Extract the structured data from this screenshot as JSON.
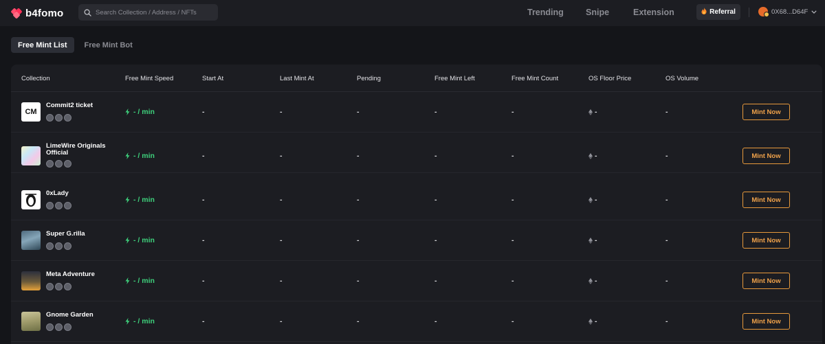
{
  "app": {
    "logo_text": "b4fomo"
  },
  "search": {
    "placeholder": "Search Collection / Address / NFTs"
  },
  "nav": {
    "trending": "Trending",
    "snipe": "Snipe",
    "extension": "Extension"
  },
  "referral": {
    "label": "Referral"
  },
  "wallet": {
    "address": "0X68...D64F"
  },
  "tabs": [
    {
      "label": "Free Mint List",
      "active": true
    },
    {
      "label": "Free Mint Bot",
      "active": false
    }
  ],
  "table": {
    "headers": {
      "collection": "Collection",
      "speed": "Free Mint Speed",
      "start_at": "Start At",
      "last_mint_at": "Last Mint At",
      "pending": "Pending",
      "free_mint_left": "Free Mint Left",
      "free_mint_count": "Free Mint Count",
      "os_floor_price": "OS Floor Price",
      "os_volume": "OS Volume"
    },
    "rows": [
      {
        "name": "Commit2 ticket",
        "thumb_text": "CM",
        "speed": "- / min",
        "start_at": "-",
        "last_mint_at": "-",
        "pending": "-",
        "free_mint_left": "-",
        "free_mint_count": "-",
        "os_floor_price": "-",
        "os_volume": "-",
        "action": "Mint Now"
      },
      {
        "name": "LimeWire Originals Official",
        "thumb_text": "",
        "speed": "- / min",
        "start_at": "-",
        "last_mint_at": "-",
        "pending": "-",
        "free_mint_left": "-",
        "free_mint_count": "-",
        "os_floor_price": "-",
        "os_volume": "-",
        "action": "Mint Now"
      },
      {
        "name": "0xLady",
        "thumb_text": "",
        "speed": "- / min",
        "start_at": "-",
        "last_mint_at": "-",
        "pending": "-",
        "free_mint_left": "-",
        "free_mint_count": "-",
        "os_floor_price": "-",
        "os_volume": "-",
        "action": "Mint Now"
      },
      {
        "name": "Super G.rilla",
        "thumb_text": "",
        "speed": "- / min",
        "start_at": "-",
        "last_mint_at": "-",
        "pending": "-",
        "free_mint_left": "-",
        "free_mint_count": "-",
        "os_floor_price": "-",
        "os_volume": "-",
        "action": "Mint Now"
      },
      {
        "name": "Meta Adventure",
        "thumb_text": "",
        "speed": "- / min",
        "start_at": "-",
        "last_mint_at": "-",
        "pending": "-",
        "free_mint_left": "-",
        "free_mint_count": "-",
        "os_floor_price": "-",
        "os_volume": "-",
        "action": "Mint Now"
      },
      {
        "name": "Gnome Garden",
        "thumb_text": "",
        "speed": "- / min",
        "start_at": "-",
        "last_mint_at": "-",
        "pending": "-",
        "free_mint_left": "-",
        "free_mint_count": "-",
        "os_floor_price": "-",
        "os_volume": "-",
        "action": "Mint Now"
      }
    ]
  },
  "icons": {
    "logo": "b4fomo-logo-icon",
    "search": "search-icon",
    "referral": "fire-icon",
    "wallet_avatar": "fox-avatar-icon",
    "wallet_menu": "chevron-down-icon",
    "speed": "lightning-icon",
    "floor": "ethereum-icon",
    "badges": [
      "verified-badge-icon",
      "verified-badge-icon",
      "verified-badge-icon"
    ]
  },
  "colors": {
    "background": "#141519",
    "surface": "#1c1d22",
    "accent_orange": "#f0a24a",
    "speed_green": "#3ed17c",
    "logo_red": "#ff4d6d"
  }
}
